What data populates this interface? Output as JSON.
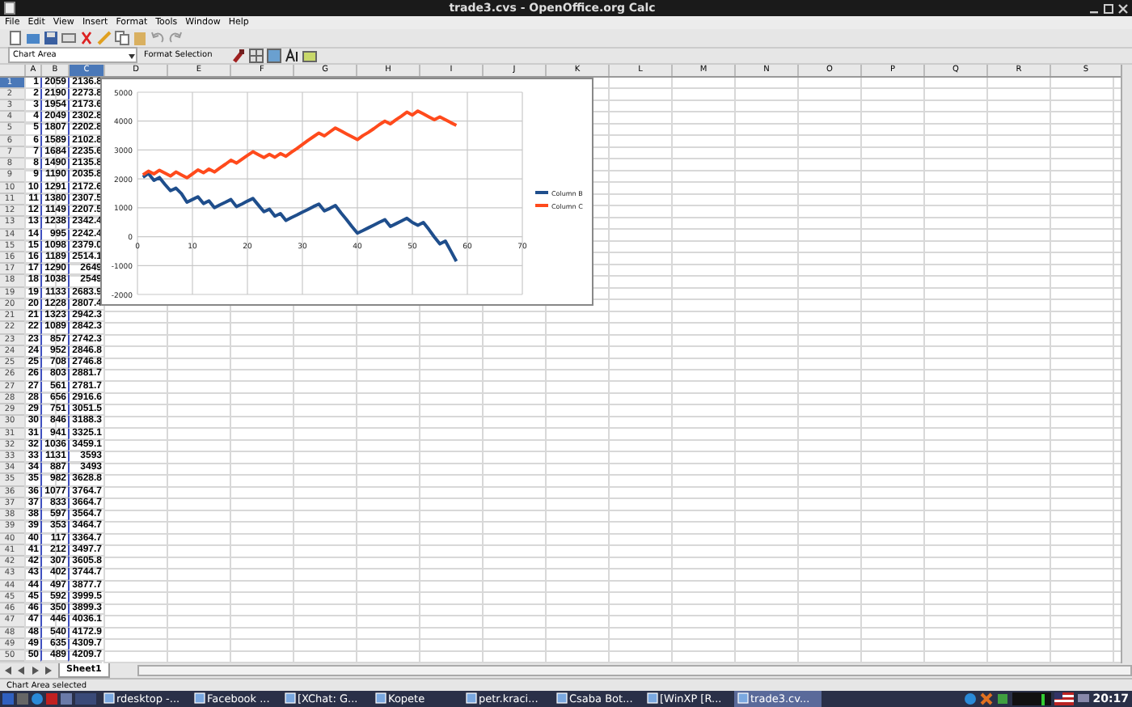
{
  "window": {
    "title": "trade3.cvs - OpenOffice.org Calc"
  },
  "menu": [
    "File",
    "Edit",
    "View",
    "Insert",
    "Format",
    "Tools",
    "Window",
    "Help"
  ],
  "chart_toolbar": {
    "name_box": "Chart Area",
    "format_button": "Format Selection"
  },
  "columns": [
    {
      "label": "A",
      "selected": false
    },
    {
      "label": "B",
      "selected": false
    },
    {
      "label": "C",
      "selected": true
    },
    {
      "label": "D",
      "selected": false
    },
    {
      "label": "E",
      "selected": false
    },
    {
      "label": "F",
      "selected": false
    },
    {
      "label": "G",
      "selected": false
    },
    {
      "label": "H",
      "selected": false
    },
    {
      "label": "I",
      "selected": false
    },
    {
      "label": "J",
      "selected": false
    },
    {
      "label": "K",
      "selected": false
    },
    {
      "label": "L",
      "selected": false
    },
    {
      "label": "M",
      "selected": false
    },
    {
      "label": "N",
      "selected": false
    },
    {
      "label": "O",
      "selected": false
    },
    {
      "label": "P",
      "selected": false
    },
    {
      "label": "Q",
      "selected": false
    },
    {
      "label": "R",
      "selected": false
    },
    {
      "label": "S",
      "selected": false
    }
  ],
  "rows": [
    {
      "number": "1",
      "selected": true,
      "cells": [
        "1",
        "2059",
        "2136.8"
      ]
    },
    {
      "number": "2",
      "selected": false,
      "cells": [
        "2",
        "2190",
        "2273.8"
      ]
    },
    {
      "number": "3",
      "selected": false,
      "cells": [
        "3",
        "1954",
        "2173.6"
      ]
    },
    {
      "number": "4",
      "selected": false,
      "cells": [
        "4",
        "2049",
        "2302.8"
      ]
    },
    {
      "number": "5",
      "selected": false,
      "cells": [
        "5",
        "1807",
        "2202.8"
      ]
    },
    {
      "number": "6",
      "selected": false,
      "cells": [
        "6",
        "1589",
        "2102.8"
      ]
    },
    {
      "number": "7",
      "selected": false,
      "cells": [
        "7",
        "1684",
        "2235.6"
      ]
    },
    {
      "number": "8",
      "selected": false,
      "cells": [
        "8",
        "1490",
        "2135.8"
      ]
    },
    {
      "number": "9",
      "selected": false,
      "cells": [
        "9",
        "1190",
        "2035.8"
      ]
    },
    {
      "number": "10",
      "selected": false,
      "cells": [
        "10",
        "1291",
        "2172.6"
      ]
    },
    {
      "number": "11",
      "selected": false,
      "cells": [
        "11",
        "1380",
        "2307.5"
      ]
    },
    {
      "number": "12",
      "selected": false,
      "cells": [
        "12",
        "1149",
        "2207.5"
      ]
    },
    {
      "number": "13",
      "selected": false,
      "cells": [
        "13",
        "1238",
        "2342.4"
      ]
    },
    {
      "number": "14",
      "selected": false,
      "cells": [
        "14",
        "995",
        "2242.4"
      ]
    },
    {
      "number": "15",
      "selected": false,
      "cells": [
        "15",
        "1098",
        "2379.0"
      ]
    },
    {
      "number": "16",
      "selected": false,
      "cells": [
        "16",
        "1189",
        "2514.1"
      ]
    },
    {
      "number": "17",
      "selected": false,
      "cells": [
        "17",
        "1290",
        "2649"
      ]
    },
    {
      "number": "18",
      "selected": false,
      "cells": [
        "18",
        "1038",
        "2549"
      ]
    },
    {
      "number": "19",
      "selected": false,
      "cells": [
        "19",
        "1133",
        "2683.9"
      ]
    },
    {
      "number": "20",
      "selected": false,
      "cells": [
        "20",
        "1228",
        "2807.4"
      ]
    },
    {
      "number": "21",
      "selected": false,
      "cells": [
        "21",
        "1323",
        "2942.3"
      ]
    },
    {
      "number": "22",
      "selected": false,
      "cells": [
        "22",
        "1089",
        "2842.3"
      ]
    },
    {
      "number": "23",
      "selected": false,
      "cells": [
        "23",
        "857",
        "2742.3"
      ]
    },
    {
      "number": "24",
      "selected": false,
      "cells": [
        "24",
        "952",
        "2846.8"
      ]
    },
    {
      "number": "25",
      "selected": false,
      "cells": [
        "25",
        "708",
        "2746.8"
      ]
    },
    {
      "number": "26",
      "selected": false,
      "cells": [
        "26",
        "803",
        "2881.7"
      ]
    },
    {
      "number": "27",
      "selected": false,
      "cells": [
        "27",
        "561",
        "2781.7"
      ]
    },
    {
      "number": "28",
      "selected": false,
      "cells": [
        "28",
        "656",
        "2916.6"
      ]
    },
    {
      "number": "29",
      "selected": false,
      "cells": [
        "29",
        "751",
        "3051.5"
      ]
    },
    {
      "number": "30",
      "selected": false,
      "cells": [
        "30",
        "846",
        "3188.3"
      ]
    },
    {
      "number": "31",
      "selected": false,
      "cells": [
        "31",
        "941",
        "3325.1"
      ]
    },
    {
      "number": "32",
      "selected": false,
      "cells": [
        "32",
        "1036",
        "3459.1"
      ]
    },
    {
      "number": "33",
      "selected": false,
      "cells": [
        "33",
        "1131",
        "3593"
      ]
    },
    {
      "number": "34",
      "selected": false,
      "cells": [
        "34",
        "887",
        "3493"
      ]
    },
    {
      "number": "35",
      "selected": false,
      "cells": [
        "35",
        "982",
        "3628.8"
      ]
    },
    {
      "number": "36",
      "selected": false,
      "cells": [
        "36",
        "1077",
        "3764.7"
      ]
    },
    {
      "number": "37",
      "selected": false,
      "cells": [
        "37",
        "833",
        "3664.7"
      ]
    },
    {
      "number": "38",
      "selected": false,
      "cells": [
        "38",
        "597",
        "3564.7"
      ]
    },
    {
      "number": "39",
      "selected": false,
      "cells": [
        "39",
        "353",
        "3464.7"
      ]
    },
    {
      "number": "40",
      "selected": false,
      "cells": [
        "40",
        "117",
        "3364.7"
      ]
    },
    {
      "number": "41",
      "selected": false,
      "cells": [
        "41",
        "212",
        "3497.7"
      ]
    },
    {
      "number": "42",
      "selected": false,
      "cells": [
        "42",
        "307",
        "3605.8"
      ]
    },
    {
      "number": "43",
      "selected": false,
      "cells": [
        "43",
        "402",
        "3744.7"
      ]
    },
    {
      "number": "44",
      "selected": false,
      "cells": [
        "44",
        "497",
        "3877.7"
      ]
    },
    {
      "number": "45",
      "selected": false,
      "cells": [
        "45",
        "592",
        "3999.5"
      ]
    },
    {
      "number": "46",
      "selected": false,
      "cells": [
        "46",
        "350",
        "3899.3"
      ]
    },
    {
      "number": "47",
      "selected": false,
      "cells": [
        "47",
        "446",
        "4036.1"
      ]
    },
    {
      "number": "48",
      "selected": false,
      "cells": [
        "48",
        "540",
        "4172.9"
      ]
    },
    {
      "number": "49",
      "selected": false,
      "cells": [
        "49",
        "635",
        "4309.7"
      ]
    },
    {
      "number": "50",
      "selected": false,
      "cells": [
        "50",
        "489",
        "4209.7"
      ]
    }
  ],
  "chart": {
    "chart_data": {
      "type": "line",
      "x": [
        1,
        2,
        3,
        4,
        5,
        6,
        7,
        8,
        9,
        10,
        11,
        12,
        13,
        14,
        15,
        16,
        17,
        18,
        19,
        20,
        21,
        22,
        23,
        24,
        25,
        26,
        27,
        28,
        29,
        30,
        31,
        32,
        33,
        34,
        35,
        36,
        37,
        38,
        39,
        40,
        41,
        42,
        43,
        44,
        45,
        46,
        47,
        48,
        49,
        50,
        51,
        52,
        53,
        54,
        55,
        56,
        57,
        58
      ],
      "series": [
        {
          "name": "Column B",
          "color": "#1f4e8c",
          "values": [
            2060,
            2190,
            1950,
            2050,
            1810,
            1590,
            1680,
            1490,
            1190,
            1290,
            1380,
            1150,
            1240,
            1000,
            1100,
            1190,
            1290,
            1040,
            1130,
            1230,
            1320,
            1090,
            860,
            950,
            710,
            800,
            560,
            660,
            750,
            850,
            940,
            1040,
            1130,
            890,
            980,
            1080,
            830,
            600,
            350,
            120,
            210,
            310,
            400,
            500,
            590,
            350,
            450,
            540,
            640,
            490,
            390,
            490,
            250,
            -10,
            -250,
            -150,
            -500,
            -850
          ]
        },
        {
          "name": "Column C",
          "color": "#ff4a1c",
          "values": [
            2140,
            2270,
            2170,
            2300,
            2200,
            2100,
            2240,
            2140,
            2040,
            2170,
            2310,
            2210,
            2340,
            2240,
            2380,
            2510,
            2650,
            2550,
            2680,
            2810,
            2940,
            2840,
            2740,
            2850,
            2750,
            2880,
            2780,
            2920,
            3050,
            3190,
            3330,
            3460,
            3590,
            3490,
            3630,
            3760,
            3660,
            3560,
            3460,
            3360,
            3500,
            3610,
            3740,
            3880,
            4000,
            3900,
            4040,
            4170,
            4310,
            4210,
            4350,
            4250,
            4150,
            4050,
            4150,
            4050,
            3950,
            3850
          ]
        }
      ],
      "grid": true,
      "legend": true,
      "xlim": [
        0,
        70
      ],
      "ylim": [
        -2000,
        5000
      ],
      "xticks": [
        0,
        10,
        20,
        30,
        40,
        50,
        60,
        70
      ],
      "yticks": [
        -2000,
        -1000,
        0,
        1000,
        2000,
        3000,
        4000,
        5000
      ]
    }
  },
  "sheet_tabs": [
    {
      "label": "Sheet1",
      "selected": true
    }
  ],
  "status_bar": "Chart Area selected",
  "taskbar": {
    "items": [
      {
        "label": "rdesktop -...",
        "selected": false
      },
      {
        "label": "Facebook ...",
        "selected": false
      },
      {
        "label": "[XChat: G...",
        "selected": false
      },
      {
        "label": "Kopete",
        "selected": false
      },
      {
        "label": "petr.kraci...",
        "selected": false
      },
      {
        "label": "Csaba Bot...",
        "selected": false
      },
      {
        "label": "[WinXP [R...",
        "selected": false
      },
      {
        "label": "trade3.cv...",
        "selected": true
      }
    ],
    "clock": "20:17"
  }
}
